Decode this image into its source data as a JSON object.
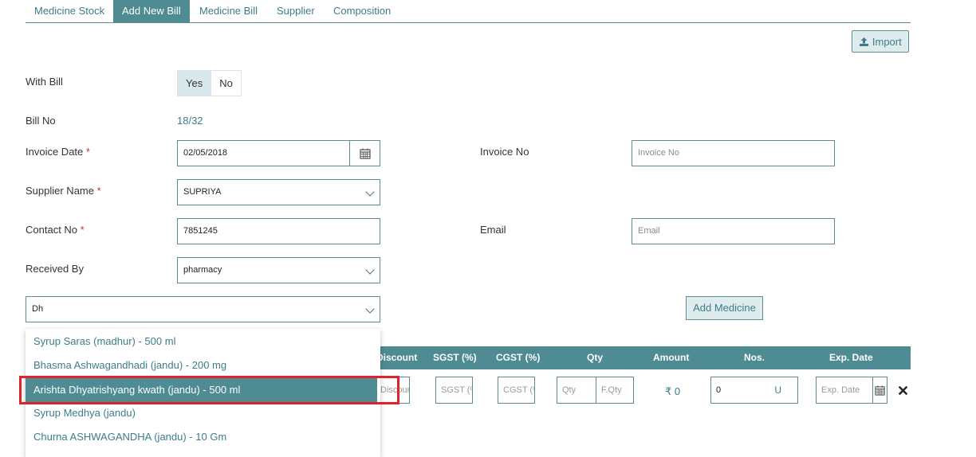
{
  "tabs": [
    {
      "label": "Medicine Stock",
      "active": false
    },
    {
      "label": "Add New Bill",
      "active": true
    },
    {
      "label": "Medicine Bill",
      "active": false
    },
    {
      "label": "Supplier",
      "active": false
    },
    {
      "label": "Composition",
      "active": false
    }
  ],
  "import_label": "Import",
  "with_bill": {
    "label": "With Bill",
    "yes": "Yes",
    "no": "No",
    "selected": "Yes"
  },
  "bill_no": {
    "label": "Bill No",
    "value": "18/32"
  },
  "invoice_date": {
    "label": "Invoice Date",
    "required": "*",
    "value": "02/05/2018"
  },
  "invoice_no": {
    "label": "Invoice No",
    "placeholder": "Invoice No"
  },
  "supplier": {
    "label": "Supplier Name",
    "required": "*",
    "value": "SUPRIYA"
  },
  "contact": {
    "label": "Contact No",
    "required": "*",
    "value": "7851245"
  },
  "email": {
    "label": "Email",
    "placeholder": "Email"
  },
  "received_by": {
    "label": "Received By",
    "value": "pharmacy"
  },
  "medicine_search": {
    "value": "Dh"
  },
  "add_medicine_label": "Add Medicine",
  "table": {
    "headers": {
      "discount": "Discount",
      "sgst": "SGST (%)",
      "cgst": "CGST (%)",
      "qty": "Qty",
      "amount": "Amount",
      "nos": "Nos.",
      "exp": "Exp. Date"
    },
    "row": {
      "discount_ph": "Discount",
      "sgst_ph": "SGST (%)",
      "cgst_ph": "CGST (%)",
      "qty_ph": "Qty",
      "fqty_ph": "F.Qty",
      "amount": "₹ 0",
      "nos_value": "0",
      "nos_unit": "U",
      "exp_ph": "Exp. Date"
    }
  },
  "dropdown_items": [
    "Syrup Saras (madhur) - 500 ml",
    "Bhasma Ashwagandhadi (jandu) - 200 mg",
    "Arishta Dhyatrishyang kwath (jandu) - 500 ml",
    "Syrup Medhya (jandu)",
    "Churna ASHWAGANDHA (jandu) - 10 Gm"
  ],
  "highlighted_index": 2,
  "colors": {
    "accent": "#4f8b93",
    "link": "#3d7d8a",
    "required": "#c0392b",
    "highlight_box": "#e0222a"
  },
  "icons": {
    "calendar": "calendar-icon",
    "chevron": "chevron-down-icon",
    "upload": "upload-icon",
    "close": "close-icon"
  }
}
